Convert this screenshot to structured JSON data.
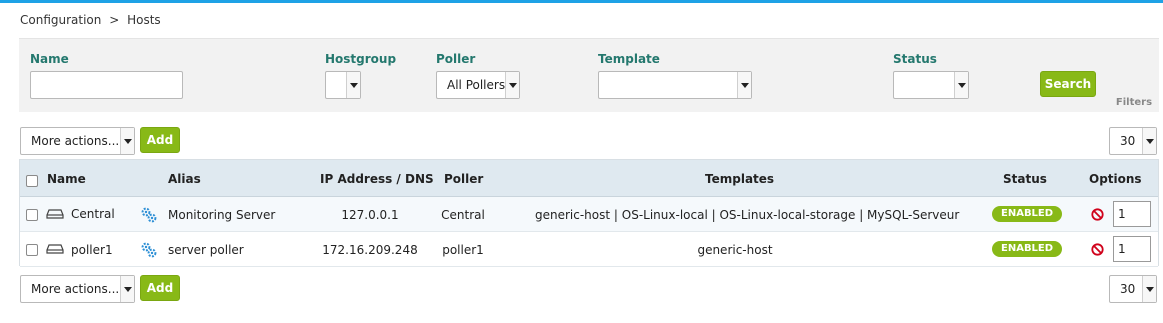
{
  "breadcrumb": {
    "item1": "Configuration",
    "separator": ">",
    "item2": "Hosts"
  },
  "filters": {
    "name_label": "Name",
    "name_value": "",
    "hostgroup_label": "Hostgroup",
    "hostgroup_value": "",
    "poller_label": "Poller",
    "poller_value": "All Pollers",
    "template_label": "Template",
    "template_value": "",
    "status_label": "Status",
    "status_value": "",
    "search_button": "Search",
    "filters_tab": "Filters"
  },
  "toolbar_top": {
    "more_actions": "More actions...",
    "add_button": "Add",
    "page_size": "30"
  },
  "toolbar_bottom": {
    "more_actions": "More actions...",
    "add_button": "Add",
    "page_size": "30"
  },
  "table": {
    "headers": {
      "name": "Name",
      "alias": "Alias",
      "ip": "IP Address / DNS",
      "poller": "Poller",
      "templates": "Templates",
      "status": "Status",
      "options": "Options"
    },
    "rows": [
      {
        "name": "Central",
        "alias": "Monitoring Server",
        "ip": "127.0.0.1",
        "poller": "Central",
        "templates": "generic-host | OS-Linux-local | OS-Linux-local-storage | MySQL-Serveur",
        "status": "ENABLED",
        "option_value": "1"
      },
      {
        "name": "poller1",
        "alias": "server poller",
        "ip": "172.16.209.248",
        "poller": "poller1",
        "templates": "generic-host",
        "status": "ENABLED",
        "option_value": "1"
      }
    ]
  },
  "colors": {
    "accent_top": "#1ea2e6",
    "label_teal": "#24786e",
    "button_green": "#88b917",
    "header_bg": "#dfe9f0",
    "disable_red": "#d0021b",
    "gear_blue": "#2d8fd5"
  },
  "icons": [
    "host-icon",
    "gear-services-icon",
    "disable-icon",
    "chevron-down-icon"
  ]
}
